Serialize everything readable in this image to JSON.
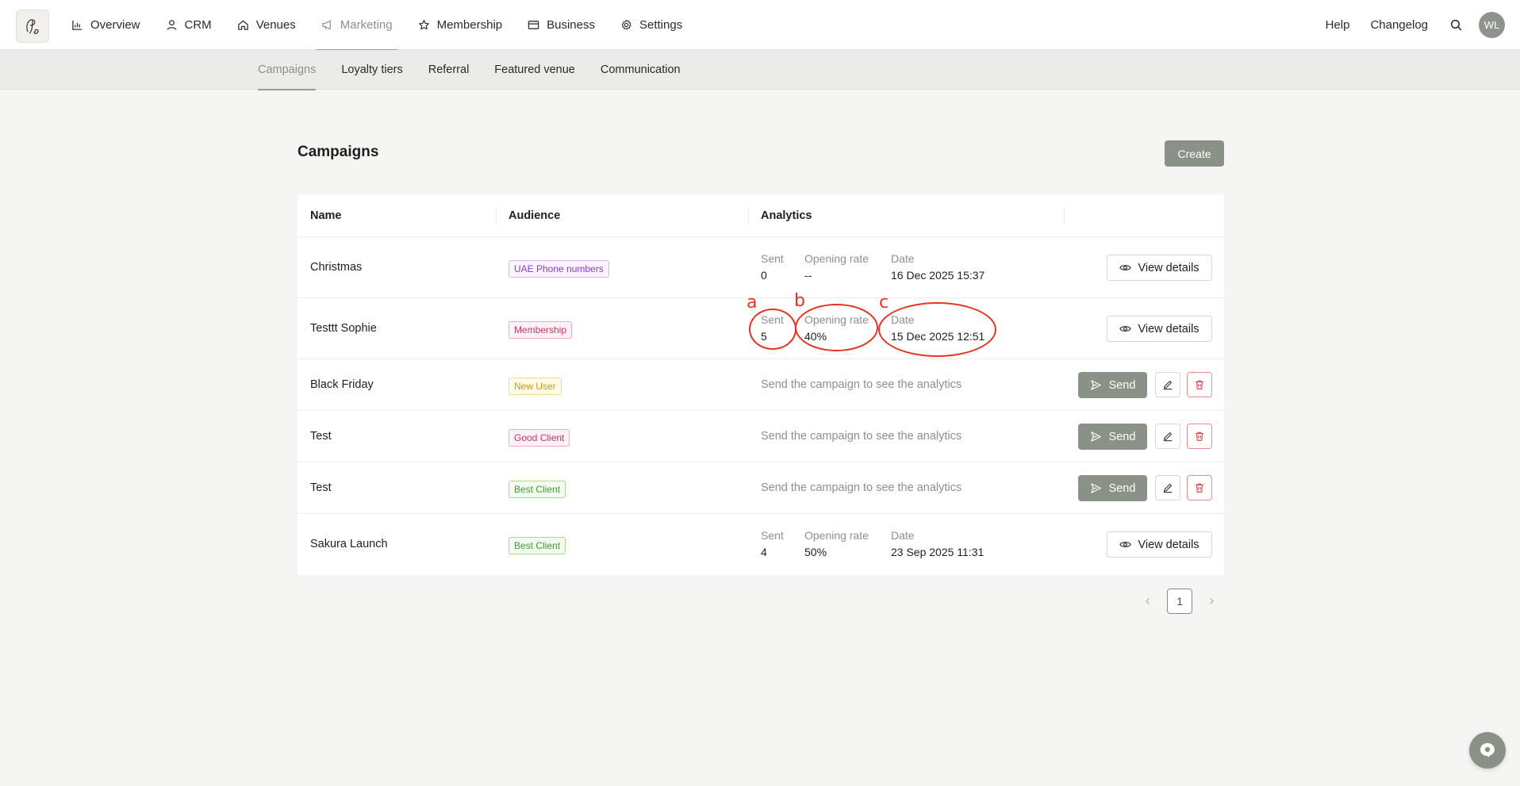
{
  "nav": {
    "items": [
      {
        "label": "Overview",
        "icon": "bar-chart-icon"
      },
      {
        "label": "CRM",
        "icon": "user-icon"
      },
      {
        "label": "Venues",
        "icon": "home-icon"
      },
      {
        "label": "Marketing",
        "icon": "megaphone-icon"
      },
      {
        "label": "Membership",
        "icon": "star-icon"
      },
      {
        "label": "Business",
        "icon": "card-icon"
      },
      {
        "label": "Settings",
        "icon": "gear-icon"
      }
    ],
    "active": "Marketing",
    "help": "Help",
    "changelog": "Changelog",
    "avatar": "WL"
  },
  "subnav": {
    "items": [
      "Campaigns",
      "Loyalty tiers",
      "Referral",
      "Featured venue",
      "Communication"
    ],
    "active": "Campaigns"
  },
  "page": {
    "title": "Campaigns",
    "create_label": "Create"
  },
  "table": {
    "headers": [
      "Name",
      "Audience",
      "Analytics"
    ],
    "analytics_labels": {
      "sent": "Sent",
      "opening_rate": "Opening rate",
      "date": "Date"
    },
    "empty_analytics": "Send the campaign to see the analytics",
    "view_label": "View details",
    "send_label": "Send",
    "rows": [
      {
        "name": "Christmas",
        "audience": "UAE Phone numbers",
        "sent": "0",
        "opening_rate": "--",
        "date": "16 Dec 2025 15:37"
      },
      {
        "name": "Testtt Sophie",
        "audience": "Membership",
        "sent": "5",
        "opening_rate": "40%",
        "date": "15 Dec 2025 12:51"
      },
      {
        "name": "Black Friday",
        "audience": "New User"
      },
      {
        "name": "Test",
        "audience": "Good Client"
      },
      {
        "name": "Test",
        "audience": "Best Client"
      },
      {
        "name": "Sakura Launch",
        "audience": "Best Client",
        "sent": "4",
        "opening_rate": "50%",
        "date": "23 Sep 2025 11:31"
      }
    ]
  },
  "annotations": {
    "a": "a",
    "b": "b",
    "c": "c"
  },
  "pagination": {
    "current": "1"
  },
  "colors": {
    "accent": "#8a9186",
    "annotation": "#e8331f",
    "tag_purple": "#8a3fc0",
    "tag_pink": "#d0306b",
    "tag_yellow": "#c99a10",
    "tag_green": "#3f9b2c"
  }
}
